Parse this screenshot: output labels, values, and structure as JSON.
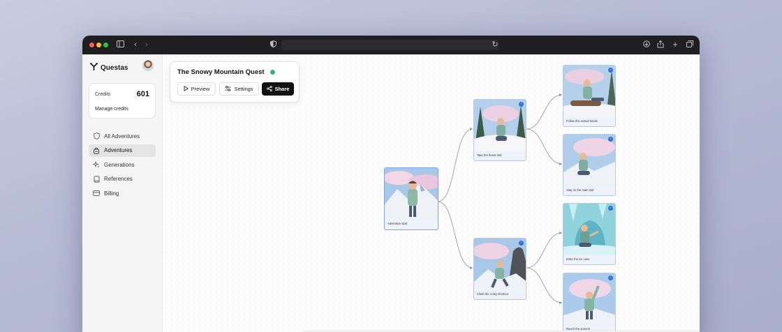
{
  "colors": {
    "accent": "#2fb57a",
    "badge": "#2f6fe0",
    "primary_button": "#111111"
  },
  "browser": {
    "icons": [
      "sidebar-icon",
      "back-icon",
      "forward-icon",
      "shield-icon",
      "reload-icon",
      "download-icon",
      "share-icon",
      "new-tab-icon",
      "tabs-icon"
    ]
  },
  "sidebar": {
    "brand": "Questas",
    "credits": {
      "label": "Credits",
      "value": "601",
      "manage": "Manage credits"
    },
    "items": [
      {
        "label": "All Adventures",
        "icon": "shield-icon"
      },
      {
        "label": "Adventures",
        "icon": "backpack-icon"
      },
      {
        "label": "Generations",
        "icon": "sparkles-icon"
      },
      {
        "label": "References",
        "icon": "book-icon"
      },
      {
        "label": "Billing",
        "icon": "card-icon"
      }
    ]
  },
  "quest": {
    "title": "The Snowy Mountain Quest",
    "preview": "Preview",
    "settings": "Settings",
    "share": "Share"
  },
  "nodes": [
    {
      "caption": "Adventure start"
    },
    {
      "caption": "Take the forest trail"
    },
    {
      "caption": "Climb the rocky shortcut"
    },
    {
      "caption": "Follow the animal tracks"
    },
    {
      "caption": "Stay on the main trail"
    },
    {
      "caption": "Enter the ice cave"
    },
    {
      "caption": "Reach the summit"
    }
  ]
}
